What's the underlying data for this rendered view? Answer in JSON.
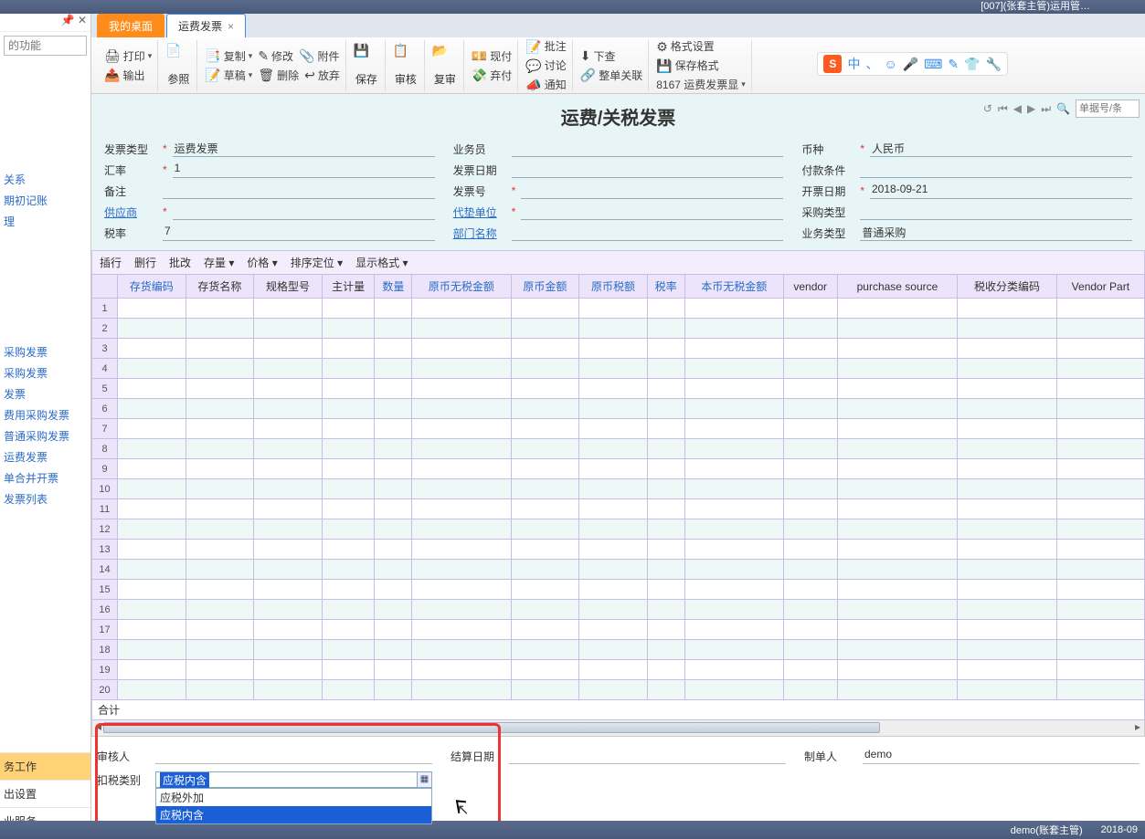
{
  "titlebar": {
    "text": "[007](张套主管)运用管…"
  },
  "left": {
    "pin": "📌",
    "close": "✕",
    "search_placeholder": "的功能",
    "nav": [
      "关系",
      "期初记账",
      "理"
    ],
    "nav2": [
      "采购发票",
      "采购发票",
      "发票",
      "费用采购发票",
      "普通采购发票",
      "运费发票",
      "单合并开票",
      "发票列表"
    ],
    "bottom": [
      {
        "label": "务工作",
        "active": true
      },
      {
        "label": "出设置",
        "active": false
      },
      {
        "label": "业服务",
        "active": false
      }
    ]
  },
  "tabs": [
    {
      "label": "我的桌面",
      "kind": "orange"
    },
    {
      "label": "运费发票",
      "kind": "active",
      "close": "×"
    }
  ],
  "toolbar": {
    "print": "打印",
    "output": "输出",
    "ref": "参照",
    "copy": "复制",
    "draft": "草稿",
    "modify": "修改",
    "delete": "删除",
    "attach": "附件",
    "abandon": "放弃",
    "save": "保存",
    "audit": "审核",
    "reaudit": "复审",
    "cash_now": "现付",
    "cash_abandon": "弃付",
    "approve": "批注",
    "discuss": "讨论",
    "notify": "通知",
    "lookup": "下查",
    "whole": "整单关联",
    "fmt_set": "格式设置",
    "fmt_save": "保存格式",
    "fmt_code": "8167 运费发票显"
  },
  "ime": {
    "chars": [
      "中",
      "、",
      "☺",
      "🎤",
      "⌨",
      "✎",
      "👕",
      "🔧"
    ]
  },
  "doc": {
    "title": "运费/关税发票",
    "search_placeholder": "单据号/条",
    "fields": {
      "invoice_type_lbl": "发票类型",
      "invoice_type_val": "运费发票",
      "rate_lbl": "汇率",
      "rate_val": "1",
      "remark_lbl": "备注",
      "remark_val": "",
      "supplier_lbl": "供应商",
      "supplier_val": "",
      "taxrate_lbl": "税率",
      "taxrate_val": "7",
      "salesman_lbl": "业务员",
      "salesman_val": "",
      "invdate_lbl": "发票日期",
      "invdate_val": "",
      "invno_lbl": "发票号",
      "invno_val": "",
      "agent_lbl": "代垫单位",
      "agent_val": "",
      "dept_lbl": "部门名称",
      "dept_val": "",
      "currency_lbl": "币种",
      "currency_val": "人民币",
      "payterm_lbl": "付款条件",
      "payterm_val": "",
      "opendate_lbl": "开票日期",
      "opendate_val": "2018-09-21",
      "purtype_lbl": "采购类型",
      "purtype_val": "",
      "biztype_lbl": "业务类型",
      "biztype_val": "普通采购"
    }
  },
  "gridtools": [
    "插行",
    "删行",
    "批改",
    "存量 ▾",
    "价格 ▾",
    "排序定位 ▾",
    "显示格式 ▾"
  ],
  "columns": [
    {
      "label": "存货编码",
      "blue": true
    },
    {
      "label": "存货名称"
    },
    {
      "label": "规格型号"
    },
    {
      "label": "主计量"
    },
    {
      "label": "数量",
      "blue": true
    },
    {
      "label": "原币无税金额",
      "blue": true
    },
    {
      "label": "原币金额",
      "blue": true
    },
    {
      "label": "原币税额",
      "blue": true
    },
    {
      "label": "税率",
      "blue": true
    },
    {
      "label": "本币无税金额",
      "blue": true
    },
    {
      "label": "vendor"
    },
    {
      "label": "purchase source"
    },
    {
      "label": "税收分类编码"
    },
    {
      "label": "Vendor Part"
    }
  ],
  "rowcount": 20,
  "totals_label": "合计",
  "foot": {
    "auditor_lbl": "审核人",
    "auditor_val": "",
    "settledate_lbl": "结算日期",
    "settledate_val": "",
    "maker_lbl": "制单人",
    "maker_val": "demo",
    "taxcat_lbl": "扣税类别",
    "taxcat_val": "应税内含",
    "dd_opts": [
      "应税外加",
      "应税内含"
    ]
  },
  "status": {
    "user": "demo(账套主管)",
    "date": "2018-09"
  }
}
